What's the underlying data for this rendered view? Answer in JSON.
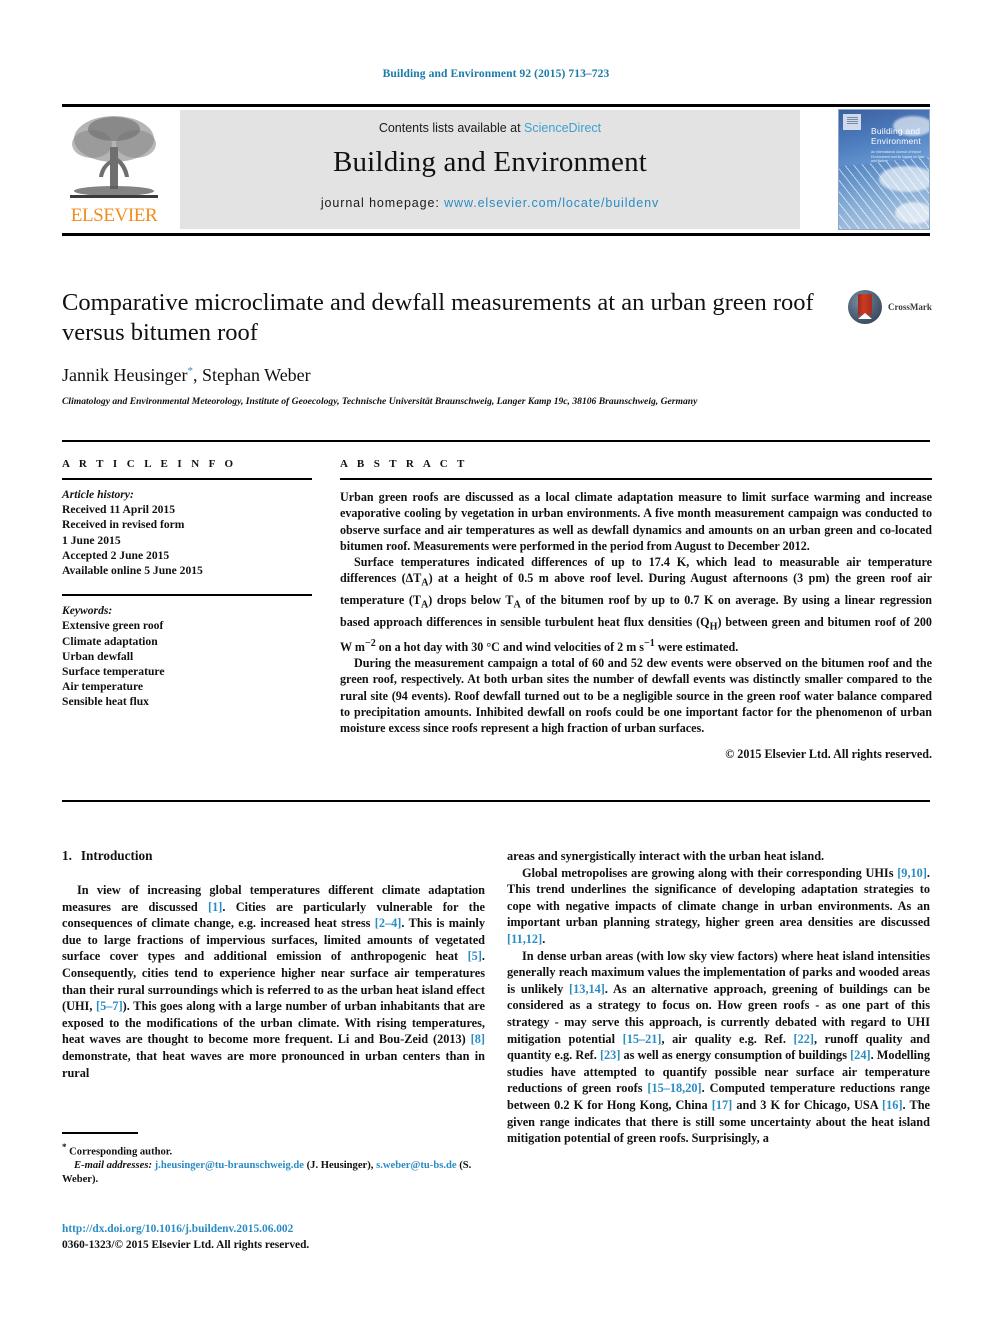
{
  "running_head": "Building and Environment 92 (2015) 713–723",
  "masthead": {
    "contents_prefix": "Contents lists available at ",
    "sciencedirect": "ScienceDirect",
    "journal_name": "Building and Environment",
    "homepage_prefix": "journal homepage: ",
    "homepage_url": "www.elsevier.com/locate/buildenv",
    "publisher": "ELSEVIER",
    "cover_title_line1": "Building and",
    "cover_title_line2": "Environment",
    "cover_subtitle": "An International Journal of Indoor Environment and its Impact on Man and Nature"
  },
  "article": {
    "title": "Comparative microclimate and dewfall measurements at an urban green roof versus bitumen roof",
    "authors": "Jannik Heusinger, Stephan Weber",
    "author_star": "*",
    "affiliation": "Climatology and Environmental Meteorology, Institute of Geoecology, Technische Universität Braunschweig, Langer Kamp 19c, 38106 Braunschweig, Germany",
    "crossmark_label": "CrossMark"
  },
  "article_info": {
    "heading": "A R T I C L E   I N F O",
    "history_label": "Article history:",
    "history": [
      "Received 11 April 2015",
      "Received in revised form",
      "1 June 2015",
      "Accepted 2 June 2015",
      "Available online 5 June 2015"
    ],
    "keywords_label": "Keywords:",
    "keywords": [
      "Extensive green roof",
      "Climate adaptation",
      "Urban dewfall",
      "Surface temperature",
      "Air temperature",
      "Sensible heat flux"
    ]
  },
  "abstract": {
    "heading": "A B S T R A C T",
    "paragraph1": "Urban green roofs are discussed as a local climate adaptation measure to limit surface warming and increase evaporative cooling by vegetation in urban environments. A five month measurement campaign was conducted to observe surface and air temperatures as well as dewfall dynamics and amounts on an urban green and co-located bitumen roof. Measurements were performed in the period from August to December 2012.",
    "paragraph2_a": "Surface temperatures indicated differences of up to 17.4 K, which lead to measurable air temperature differences (ΔT",
    "paragraph2_b": ") at a height of 0.5 m above roof level. During August afternoons (3 pm) the green roof air temperature (T",
    "paragraph2_c": ") drops below T",
    "paragraph2_d": " of the bitumen roof by up to 0.7 K on average. By using a linear regression based approach differences in sensible turbulent heat flux densities (Q",
    "paragraph2_e": ") between green and bitumen roof of 200 W m",
    "paragraph2_f": " on a hot day with 30 °C and wind velocities of 2 m s",
    "paragraph2_g": " were estimated.",
    "paragraph3": "During the measurement campaign a total of 60 and 52 dew events were observed on the bitumen roof and the green roof, respectively. At both urban sites the number of dewfall events was distinctly smaller compared to the rural site (94 events). Roof dewfall turned out to be a negligible source in the green roof water balance compared to precipitation amounts. Inhibited dewfall on roofs could be one important factor for the phenomenon of urban moisture excess since roofs represent a high fraction of urban surfaces.",
    "copyright": "© 2015 Elsevier Ltd. All rights reserved."
  },
  "introduction": {
    "number": "1.",
    "title": "Introduction",
    "left_p1_a": "In view of increasing global temperatures different climate adaptation measures are discussed ",
    "left_p1_ref1": "[1]",
    "left_p1_b": ". Cities are particularly vulnerable for the consequences of climate change, e.g. increased heat stress ",
    "left_p1_ref2": "[2–4]",
    "left_p1_c": ". This is mainly due to large fractions of impervious surfaces, limited amounts of vegetated surface cover types and additional emission of anthropogenic heat ",
    "left_p1_ref3": "[5]",
    "left_p1_d": ". Consequently, cities tend to experience higher near surface air temperatures than their rural surroundings which is referred to as the urban heat island effect (UHI, ",
    "left_p1_ref4": "[5–7]",
    "left_p1_e": "). This goes along with a large number of urban inhabitants that are exposed to the modifications of the urban climate. With rising temperatures, heat waves are thought to become more frequent. Li and Bou-Zeid (2013) ",
    "left_p1_ref5": "[8]",
    "left_p1_f": " demonstrate, that heat waves are more pronounced in urban centers than in rural",
    "right_p0": "areas and synergistically interact with the urban heat island.",
    "right_p1_a": "Global metropolises are growing along with their corresponding UHIs ",
    "right_p1_ref1": "[9,10]",
    "right_p1_b": ". This trend underlines the significance of developing adaptation strategies to cope with negative impacts of climate change in urban environments. As an important urban planning strategy, higher green area densities are discussed ",
    "right_p1_ref2": "[11,12]",
    "right_p1_c": ".",
    "right_p2_a": "In dense urban areas (with low sky view factors) where heat island intensities generally reach maximum values the implementation of parks and wooded areas is unlikely ",
    "right_p2_ref1": "[13,14]",
    "right_p2_b": ". As an alternative approach, greening of buildings can be considered as a strategy to focus on. How green roofs - as one part of this strategy - may serve this approach, is currently debated with regard to UHI mitigation potential ",
    "right_p2_ref2": "[15–21]",
    "right_p2_c": ", air quality e.g. Ref. ",
    "right_p2_ref3": "[22]",
    "right_p2_d": ", runoff quality and quantity e.g. Ref. ",
    "right_p2_ref4": "[23]",
    "right_p2_e": " as well as energy consumption of buildings ",
    "right_p2_ref5": "[24]",
    "right_p2_f": ". Modelling studies have attempted to quantify possible near surface air temperature reductions of green roofs ",
    "right_p2_ref6": "[15–18,20]",
    "right_p2_g": ". Computed temperature reductions range between 0.2 K for Hong Kong, China ",
    "right_p2_ref7": "[17]",
    "right_p2_h": " and 3 K for Chicago, USA ",
    "right_p2_ref8": "[16]",
    "right_p2_i": ". The given range indicates that there is still some uncertainty about the heat island mitigation potential of green roofs. Surprisingly, a"
  },
  "footnote": {
    "corresponding_star": "*",
    "corresponding": " Corresponding author.",
    "email_label": "E-mail addresses:",
    "email1": "j.heusinger@tu-braunschweig.de",
    "email1_name": " (J. Heusinger), ",
    "email2": "s.weber@tu-bs.de",
    "email2_name": " (S. Weber)."
  },
  "footer": {
    "doi": "http://dx.doi.org/10.1016/j.buildenv.2015.06.002",
    "issn": "0360-1323/© 2015 Elsevier Ltd. All rights reserved."
  },
  "colors": {
    "link": "#2b8cc4",
    "running_head": "#1a7aa8",
    "elsevier_orange": "#f08d1c",
    "band_gray": "#e3e3e3"
  }
}
